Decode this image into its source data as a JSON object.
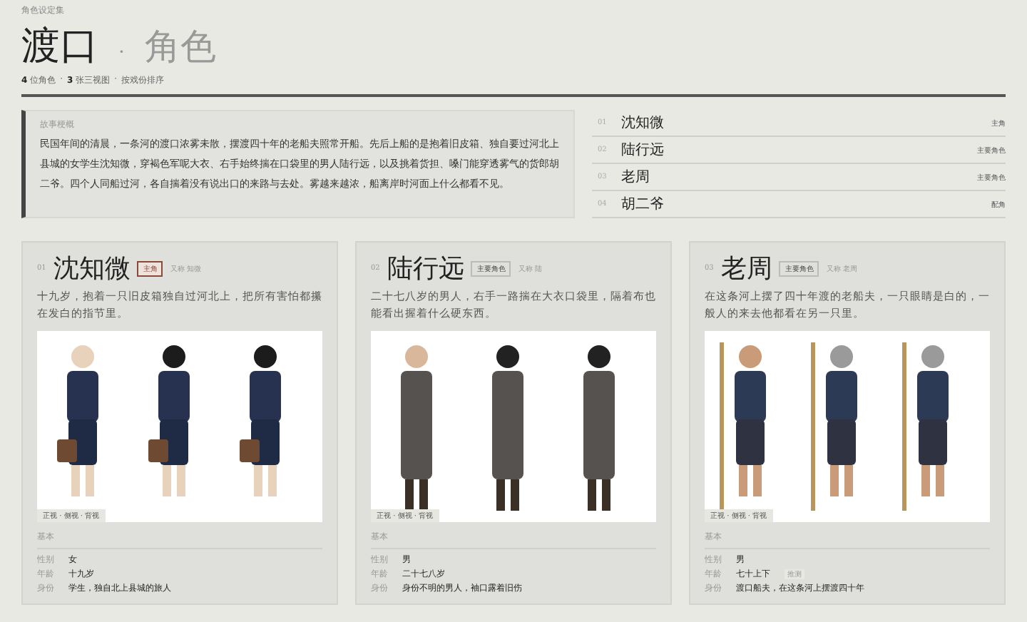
{
  "header": {
    "eyebrow": "角色设定集",
    "title": "渡口",
    "separator": "·",
    "subtitle": "角色",
    "stats": [
      {
        "count": "4",
        "label": "位角色"
      },
      {
        "count": "3",
        "label": "张三视图"
      }
    ],
    "sort": "按戏份排序"
  },
  "synopsis": {
    "label": "故事梗概",
    "text": "民国年间的清晨，一条河的渡口浓雾未散，摆渡四十年的老船夫照常开船。先后上船的是抱着旧皮箱、独自要过河北上县城的女学生沈知微，穿褐色军呢大衣、右手始终揣在口袋里的男人陆行远，以及挑着货担、嗓门能穿透雾气的货郎胡二爷。四个人同船过河，各自揣着没有说出口的来路与去处。雾越来越浓，船离岸时河面上什么都看不见。"
  },
  "roster": [
    {
      "number": "01",
      "name": "沈知微",
      "role": "主角"
    },
    {
      "number": "02",
      "name": "陆行远",
      "role": "主要角色"
    },
    {
      "number": "03",
      "name": "老周",
      "role": "主要角色"
    },
    {
      "number": "04",
      "name": "胡二爷",
      "role": "配角"
    }
  ],
  "cards": [
    {
      "number": "01",
      "name": "沈知微",
      "tag": "主角",
      "lead": true,
      "alias": "又称 知微",
      "description": "十九岁，抱着一只旧皮箱独自过河北上，把所有害怕都攥在发白的指节里。",
      "views": "正视 · 侧视 · 背视",
      "section": "基本",
      "fields": [
        {
          "label": "性别",
          "value": "女"
        },
        {
          "label": "年龄",
          "value": "十九岁"
        },
        {
          "label": "身份",
          "value": "学生，独自北上县城的旅人"
        }
      ]
    },
    {
      "number": "02",
      "name": "陆行远",
      "tag": "主要角色",
      "lead": false,
      "alias": "又称 陆",
      "description": "二十七八岁的男人，右手一路揣在大衣口袋里，隔着布也能看出握着什么硬东西。",
      "views": "正视 · 侧视 · 背视",
      "section": "基本",
      "fields": [
        {
          "label": "性别",
          "value": "男"
        },
        {
          "label": "年龄",
          "value": "二十七八岁"
        },
        {
          "label": "身份",
          "value": "身份不明的男人，袖口露着旧伤"
        }
      ]
    },
    {
      "number": "03",
      "name": "老周",
      "tag": "主要角色",
      "lead": false,
      "alias": "又称 老周",
      "description": "在这条河上摆了四十年渡的老船夫，一只眼睛是白的，一般人的来去他都看在另一只里。",
      "views": "正视 · 侧视 · 背视",
      "section": "基本",
      "fields": [
        {
          "label": "性别",
          "value": "男"
        },
        {
          "label": "年龄",
          "value": "七十上下",
          "note": "推测"
        },
        {
          "label": "身份",
          "value": "渡口船夫，在这条河上摆渡四十年"
        }
      ]
    }
  ]
}
